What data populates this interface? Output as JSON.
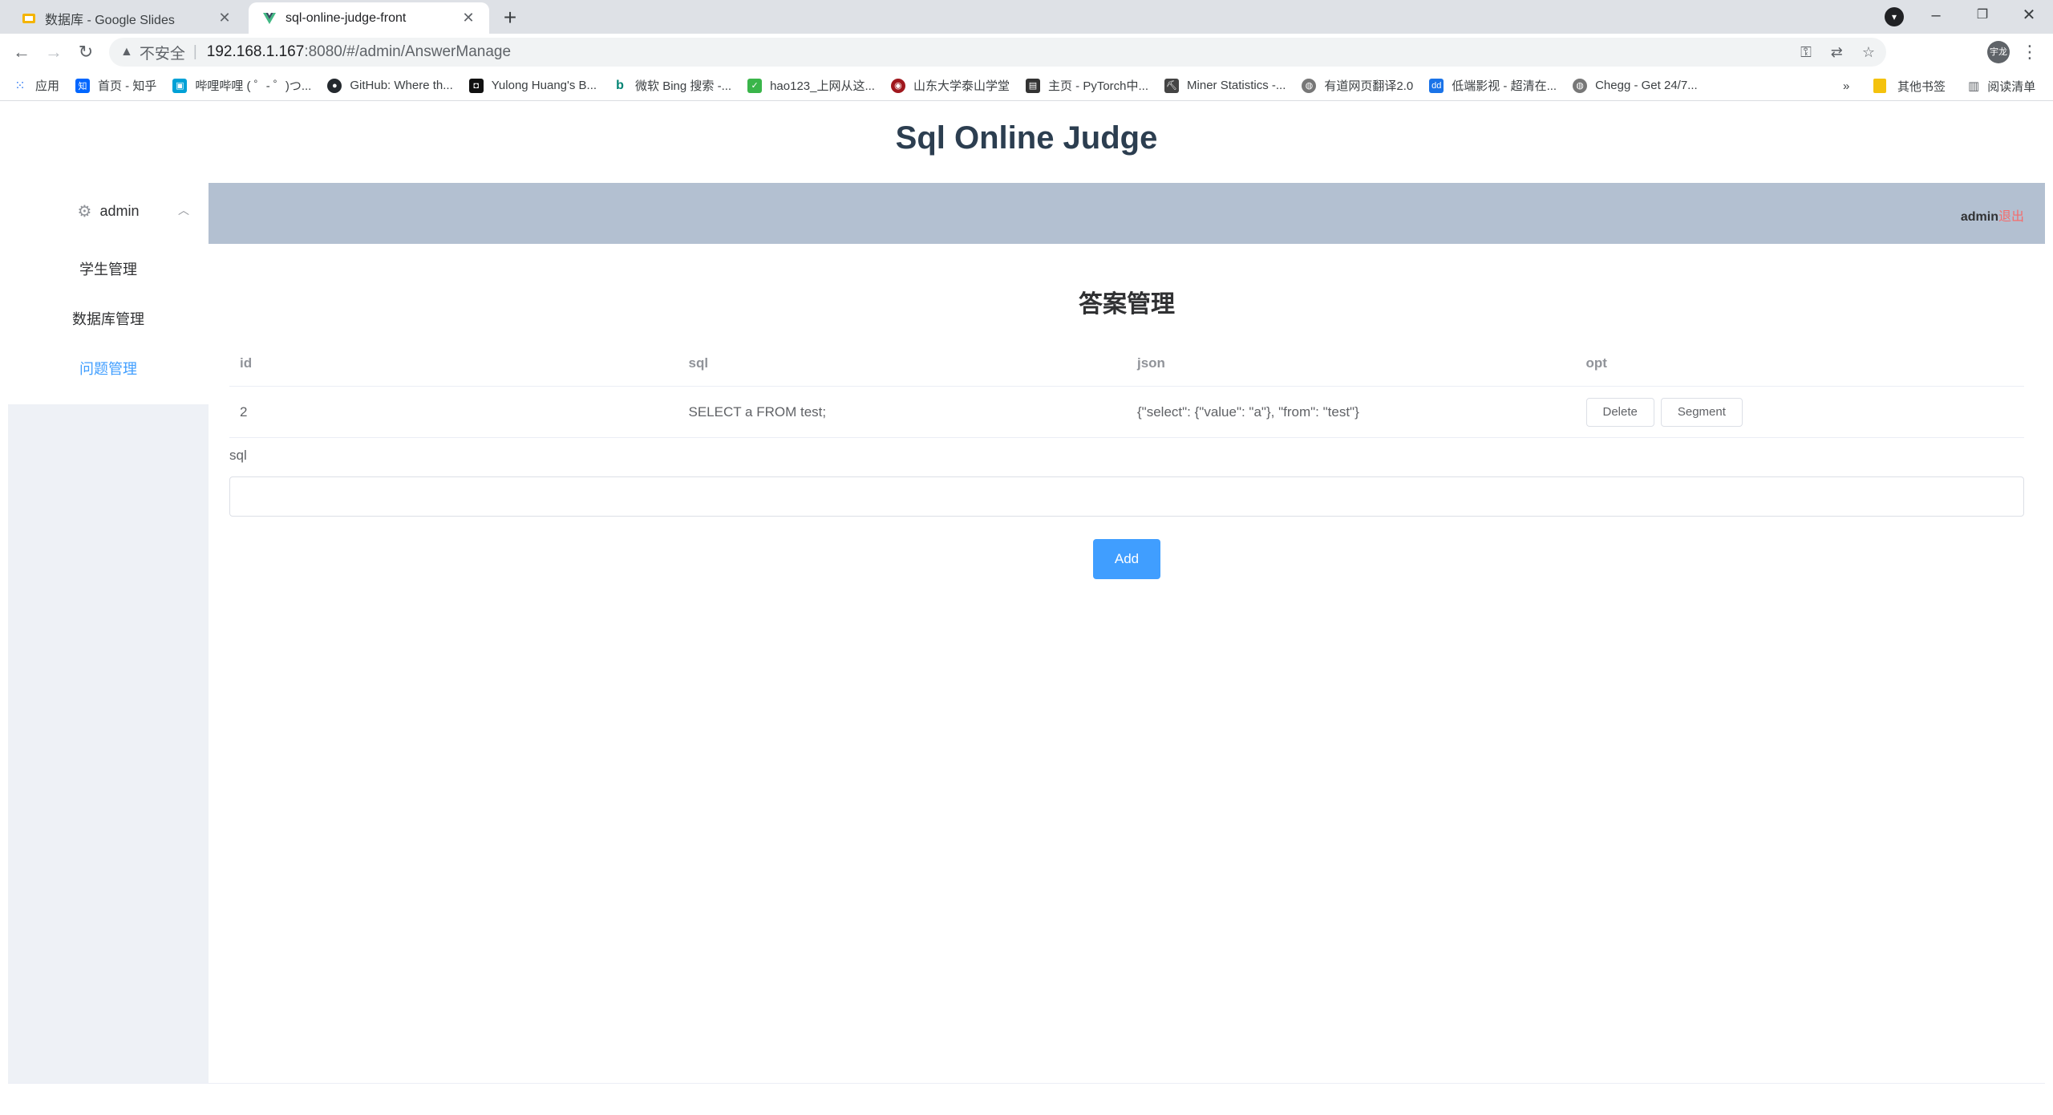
{
  "browser": {
    "tabs": [
      {
        "title": "数据库 - Google Slides",
        "favicon_color": "#f4b400",
        "active": false
      },
      {
        "title": "sql-online-judge-front",
        "favicon_color": "#41b883",
        "active": true
      }
    ],
    "new_tab_symbol": "+",
    "window_controls": {
      "minimize": "–",
      "restore": "❐",
      "close": "✕"
    },
    "address": {
      "security_label": "不安全",
      "separator": "|",
      "host": "192.168.1.167",
      "path": ":8080/#/admin/AnswerManage"
    },
    "profile_label": "宇龙",
    "bookmarks": [
      {
        "label": "应用",
        "icon": "apps-grid-icon",
        "color": "#4285f4"
      },
      {
        "label": "首页 - 知乎",
        "icon": "zhihu-icon",
        "color": "#0066ff"
      },
      {
        "label": "哔哩哔哩 ( ゜- ゜)つ...",
        "icon": "bilibili-icon",
        "color": "#00a1d6"
      },
      {
        "label": "GitHub: Where th...",
        "icon": "github-icon",
        "color": "#24292e"
      },
      {
        "label": "Yulong Huang's B...",
        "icon": "blog-icon",
        "color": "#111111"
      },
      {
        "label": "微软 Bing 搜索 -...",
        "icon": "bing-icon",
        "color": "#008373"
      },
      {
        "label": "hao123_上网从这...",
        "icon": "hao123-icon",
        "color": "#3ab54a"
      },
      {
        "label": "山东大学泰山学堂",
        "icon": "sdu-icon",
        "color": "#a0181e"
      },
      {
        "label": "主页 - PyTorch中...",
        "icon": "pytorch-icon",
        "color": "#333333"
      },
      {
        "label": "Miner Statistics -...",
        "icon": "miner-icon",
        "color": "#444444"
      },
      {
        "label": "有道网页翻译2.0",
        "icon": "globe-icon",
        "color": "#777777"
      },
      {
        "label": "低端影视 - 超清在...",
        "icon": "ddys-icon",
        "color": "#1a73e8"
      },
      {
        "label": "Chegg - Get 24/7...",
        "icon": "globe-icon",
        "color": "#777777"
      }
    ],
    "bookmarks_overflow": "»",
    "other_bookmarks": "其他书签",
    "reading_list": "阅读清单"
  },
  "app": {
    "title": "Sql Online Judge",
    "sidebar": {
      "user_label": "admin",
      "items": [
        {
          "label": "学生管理",
          "active": false
        },
        {
          "label": "数据库管理",
          "active": false
        },
        {
          "label": "问题管理",
          "active": true
        }
      ]
    },
    "header": {
      "username": "admin",
      "logout_label": "退出"
    },
    "section_title": "答案管理",
    "table": {
      "columns": [
        "id",
        "sql",
        "json",
        "opt"
      ],
      "rows": [
        {
          "id": "2",
          "sql": "SELECT a FROM test;",
          "json": "{\"select\": {\"value\": \"a\"}, \"from\": \"test\"}"
        }
      ],
      "row_actions": {
        "delete": "Delete",
        "segment": "Segment"
      }
    },
    "form": {
      "sql_label": "sql",
      "sql_value": "",
      "add_button": "Add"
    },
    "colors": {
      "accent": "#409eff",
      "header_band": "#b3c0d1",
      "sidebar_bg": "#eef1f6",
      "logout": "#f56c6c",
      "title": "#2c3e50"
    }
  }
}
